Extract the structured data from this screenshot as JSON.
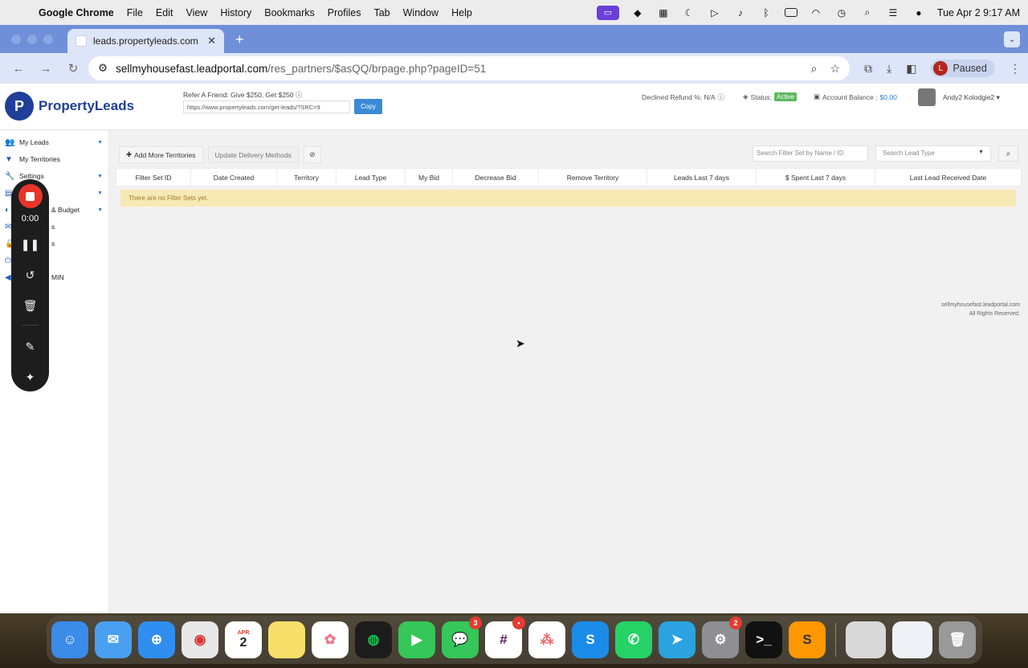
{
  "menubar": {
    "app": "Google Chrome",
    "items": [
      "File",
      "Edit",
      "View",
      "History",
      "Bookmarks",
      "Profiles",
      "Tab",
      "Window",
      "Help"
    ],
    "clock": "Tue Apr 2  9:17 AM"
  },
  "browser": {
    "tab_title": "leads.propertyleads.com - M",
    "url_host": "sellmyhousefast.leadportal.com",
    "url_path": "/res_partners/$asQQ/brpage.php?pageID=51",
    "profile_initial": "L",
    "profile_status": "Paused"
  },
  "header": {
    "logo_mark": "P",
    "logo_text": "PropertyLeads",
    "refer_label": "Refer A Friend: Give $250, Get $250",
    "refer_link": "https://www.propertyleads.com/get-leads/?SRC=9",
    "copy_label": "Copy",
    "declined_refund": "Declined Refund %: N/A",
    "status_label": "Status:",
    "status_value": "Active",
    "balance_label": "Account Balance :",
    "balance_value": "$0.00",
    "user_name": "Andy2 Kolodgie2"
  },
  "sidebar": {
    "items": [
      {
        "label": "My Leads",
        "icon": "users-icon"
      },
      {
        "label": "My Territories",
        "icon": "filter-icon"
      },
      {
        "label": "Settings",
        "icon": "wrench-icon"
      },
      {
        "label": "",
        "icon": "list-icon"
      },
      {
        "label": "& Budget",
        "icon": "budget-icon"
      },
      {
        "label": "s",
        "icon": "mail-icon"
      },
      {
        "label": "s",
        "icon": "lock-icon"
      },
      {
        "label": "",
        "icon": "power-icon"
      },
      {
        "label": "MIN",
        "icon": "back-icon"
      }
    ]
  },
  "recorder": {
    "time": "0:00"
  },
  "content": {
    "add_button": "Add More Territories",
    "update_button": "Update Delivery Methods",
    "search_placeholder": "Search Filter Set by Name / ID",
    "lead_type_placeholder": "Search Lead Type",
    "columns": [
      "Filter Set ID",
      "Date Created",
      "Territory",
      "Lead Type",
      "My Bid",
      "Decrease Bid",
      "Remove Territory",
      "Leads Last 7 days",
      "$ Spent Last 7 days",
      "Last Lead Received Date"
    ],
    "empty_message": "There are no Filter Sets yet."
  },
  "footer": {
    "site": "sellmyhousefast.leadportal.com",
    "rights": "All Rights Reserved."
  },
  "dock": {
    "calendar_month": "APR",
    "calendar_day": "2",
    "messages_badge": "3",
    "settings_badge": "2"
  },
  "colors": {
    "brand": "#1f3f98",
    "active_badge": "#5cb85c",
    "copy_button": "#3a8ad6",
    "empty_row": "#f7e9b3",
    "record": "#e8352a"
  }
}
